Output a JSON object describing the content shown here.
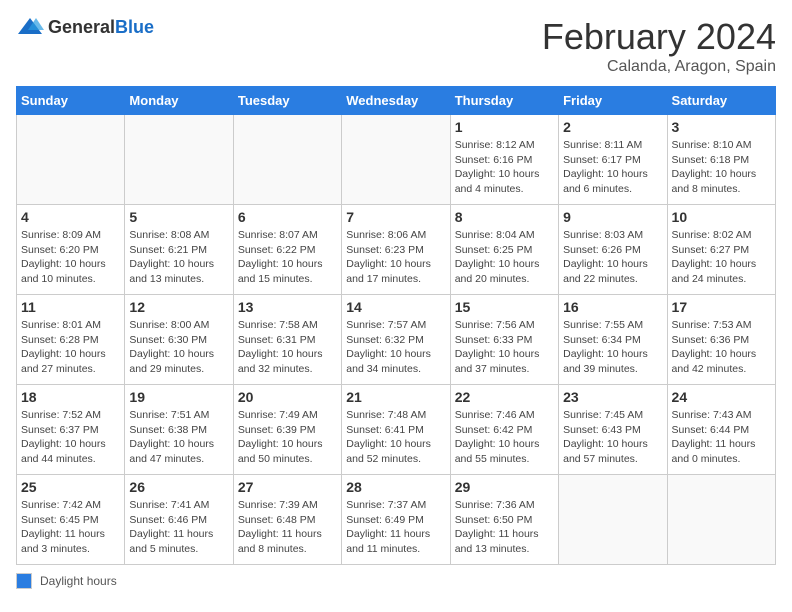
{
  "header": {
    "logo_general": "General",
    "logo_blue": "Blue",
    "month": "February 2024",
    "location": "Calanda, Aragon, Spain"
  },
  "days_of_week": [
    "Sunday",
    "Monday",
    "Tuesday",
    "Wednesday",
    "Thursday",
    "Friday",
    "Saturday"
  ],
  "legend": {
    "box_label": "Daylight hours"
  },
  "weeks": [
    {
      "days": [
        {
          "number": "",
          "info": "",
          "empty": true
        },
        {
          "number": "",
          "info": "",
          "empty": true
        },
        {
          "number": "",
          "info": "",
          "empty": true
        },
        {
          "number": "",
          "info": "",
          "empty": true
        },
        {
          "number": "1",
          "info": "Sunrise: 8:12 AM\nSunset: 6:16 PM\nDaylight: 10 hours\nand 4 minutes."
        },
        {
          "number": "2",
          "info": "Sunrise: 8:11 AM\nSunset: 6:17 PM\nDaylight: 10 hours\nand 6 minutes."
        },
        {
          "number": "3",
          "info": "Sunrise: 8:10 AM\nSunset: 6:18 PM\nDaylight: 10 hours\nand 8 minutes."
        }
      ]
    },
    {
      "days": [
        {
          "number": "4",
          "info": "Sunrise: 8:09 AM\nSunset: 6:20 PM\nDaylight: 10 hours\nand 10 minutes."
        },
        {
          "number": "5",
          "info": "Sunrise: 8:08 AM\nSunset: 6:21 PM\nDaylight: 10 hours\nand 13 minutes."
        },
        {
          "number": "6",
          "info": "Sunrise: 8:07 AM\nSunset: 6:22 PM\nDaylight: 10 hours\nand 15 minutes."
        },
        {
          "number": "7",
          "info": "Sunrise: 8:06 AM\nSunset: 6:23 PM\nDaylight: 10 hours\nand 17 minutes."
        },
        {
          "number": "8",
          "info": "Sunrise: 8:04 AM\nSunset: 6:25 PM\nDaylight: 10 hours\nand 20 minutes."
        },
        {
          "number": "9",
          "info": "Sunrise: 8:03 AM\nSunset: 6:26 PM\nDaylight: 10 hours\nand 22 minutes."
        },
        {
          "number": "10",
          "info": "Sunrise: 8:02 AM\nSunset: 6:27 PM\nDaylight: 10 hours\nand 24 minutes."
        }
      ]
    },
    {
      "days": [
        {
          "number": "11",
          "info": "Sunrise: 8:01 AM\nSunset: 6:28 PM\nDaylight: 10 hours\nand 27 minutes."
        },
        {
          "number": "12",
          "info": "Sunrise: 8:00 AM\nSunset: 6:30 PM\nDaylight: 10 hours\nand 29 minutes."
        },
        {
          "number": "13",
          "info": "Sunrise: 7:58 AM\nSunset: 6:31 PM\nDaylight: 10 hours\nand 32 minutes."
        },
        {
          "number": "14",
          "info": "Sunrise: 7:57 AM\nSunset: 6:32 PM\nDaylight: 10 hours\nand 34 minutes."
        },
        {
          "number": "15",
          "info": "Sunrise: 7:56 AM\nSunset: 6:33 PM\nDaylight: 10 hours\nand 37 minutes."
        },
        {
          "number": "16",
          "info": "Sunrise: 7:55 AM\nSunset: 6:34 PM\nDaylight: 10 hours\nand 39 minutes."
        },
        {
          "number": "17",
          "info": "Sunrise: 7:53 AM\nSunset: 6:36 PM\nDaylight: 10 hours\nand 42 minutes."
        }
      ]
    },
    {
      "days": [
        {
          "number": "18",
          "info": "Sunrise: 7:52 AM\nSunset: 6:37 PM\nDaylight: 10 hours\nand 44 minutes."
        },
        {
          "number": "19",
          "info": "Sunrise: 7:51 AM\nSunset: 6:38 PM\nDaylight: 10 hours\nand 47 minutes."
        },
        {
          "number": "20",
          "info": "Sunrise: 7:49 AM\nSunset: 6:39 PM\nDaylight: 10 hours\nand 50 minutes."
        },
        {
          "number": "21",
          "info": "Sunrise: 7:48 AM\nSunset: 6:41 PM\nDaylight: 10 hours\nand 52 minutes."
        },
        {
          "number": "22",
          "info": "Sunrise: 7:46 AM\nSunset: 6:42 PM\nDaylight: 10 hours\nand 55 minutes."
        },
        {
          "number": "23",
          "info": "Sunrise: 7:45 AM\nSunset: 6:43 PM\nDaylight: 10 hours\nand 57 minutes."
        },
        {
          "number": "24",
          "info": "Sunrise: 7:43 AM\nSunset: 6:44 PM\nDaylight: 11 hours\nand 0 minutes."
        }
      ]
    },
    {
      "days": [
        {
          "number": "25",
          "info": "Sunrise: 7:42 AM\nSunset: 6:45 PM\nDaylight: 11 hours\nand 3 minutes."
        },
        {
          "number": "26",
          "info": "Sunrise: 7:41 AM\nSunset: 6:46 PM\nDaylight: 11 hours\nand 5 minutes."
        },
        {
          "number": "27",
          "info": "Sunrise: 7:39 AM\nSunset: 6:48 PM\nDaylight: 11 hours\nand 8 minutes."
        },
        {
          "number": "28",
          "info": "Sunrise: 7:37 AM\nSunset: 6:49 PM\nDaylight: 11 hours\nand 11 minutes."
        },
        {
          "number": "29",
          "info": "Sunrise: 7:36 AM\nSunset: 6:50 PM\nDaylight: 11 hours\nand 13 minutes."
        },
        {
          "number": "",
          "info": "",
          "empty": true
        },
        {
          "number": "",
          "info": "",
          "empty": true
        }
      ]
    }
  ]
}
